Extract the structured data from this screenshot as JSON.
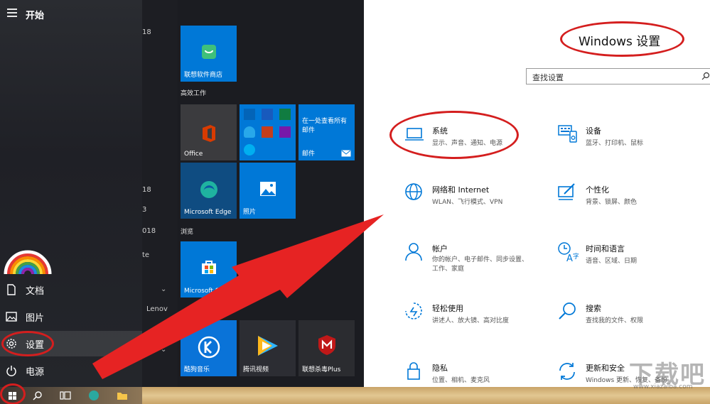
{
  "start_menu": {
    "title": "开始",
    "items": [
      {
        "label": "文档",
        "icon": "document-icon"
      },
      {
        "label": "图片",
        "icon": "pictures-icon"
      },
      {
        "label": "设置",
        "icon": "gear-icon"
      },
      {
        "label": "电源",
        "icon": "power-icon"
      }
    ]
  },
  "app_list": {
    "fragments": [
      "18",
      "18",
      "3",
      "018",
      "te",
      "Lenov"
    ]
  },
  "tiles": {
    "groups": [
      "高效工作",
      "浏览"
    ],
    "items": [
      {
        "label": "联想软件商店",
        "color": "#0078d7"
      },
      {
        "label": "Office",
        "color": "#3b3b3e"
      },
      {
        "label": "在一处查看所有邮件",
        "sublabel": "邮件",
        "color": "#0078d7"
      },
      {
        "label": "Microsoft Edge",
        "color": "#0f4c81"
      },
      {
        "label": "照片",
        "color": "#0078d7"
      },
      {
        "label": "Microsoft Store",
        "color": "#0078d7"
      },
      {
        "label": "酷狗音乐",
        "color": "#0a73d8"
      },
      {
        "label": "腾讯视频",
        "color": "#2c2d33"
      },
      {
        "label": "联想杀毒Plus",
        "color": "#2b2c30"
      }
    ]
  },
  "settings": {
    "title": "Windows 设置",
    "search_placeholder": "查找设置",
    "categories": [
      {
        "name": "系统",
        "desc": "显示、声音、通知、电源",
        "icon": "laptop-icon"
      },
      {
        "name": "设备",
        "desc": "蓝牙、打印机、鼠标",
        "icon": "keyboard-icon"
      },
      {
        "name": "网络和 Internet",
        "desc": "WLAN、飞行模式、VPN",
        "icon": "globe-icon"
      },
      {
        "name": "个性化",
        "desc": "背景、锁屏、颜色",
        "icon": "paint-icon"
      },
      {
        "name": "帐户",
        "desc": "你的帐户、电子邮件、同步设置、工作、家庭",
        "desc_line1": "你的帐户、电子邮件、同步设置、",
        "desc_line2": "工作、家庭",
        "icon": "person-icon"
      },
      {
        "name": "时间和语言",
        "desc": "语音、区域、日期",
        "icon": "time-language-icon"
      },
      {
        "name": "轻松使用",
        "desc": "讲述人、放大镜、高对比度",
        "icon": "ease-of-access-icon"
      },
      {
        "name": "搜索",
        "desc": "查找我的文件、权限",
        "icon": "search-icon"
      },
      {
        "name": "隐私",
        "desc": "位置、相机、麦克风",
        "icon": "lock-icon"
      },
      {
        "name": "更新和安全",
        "desc": "Windows 更新、恢复、备份",
        "icon": "sync-icon"
      }
    ]
  },
  "watermark": {
    "text": "下载吧",
    "sub": "www.xiazaiba.com"
  },
  "colors": {
    "accent": "#0078d7",
    "annotation": "#d41e1e"
  }
}
